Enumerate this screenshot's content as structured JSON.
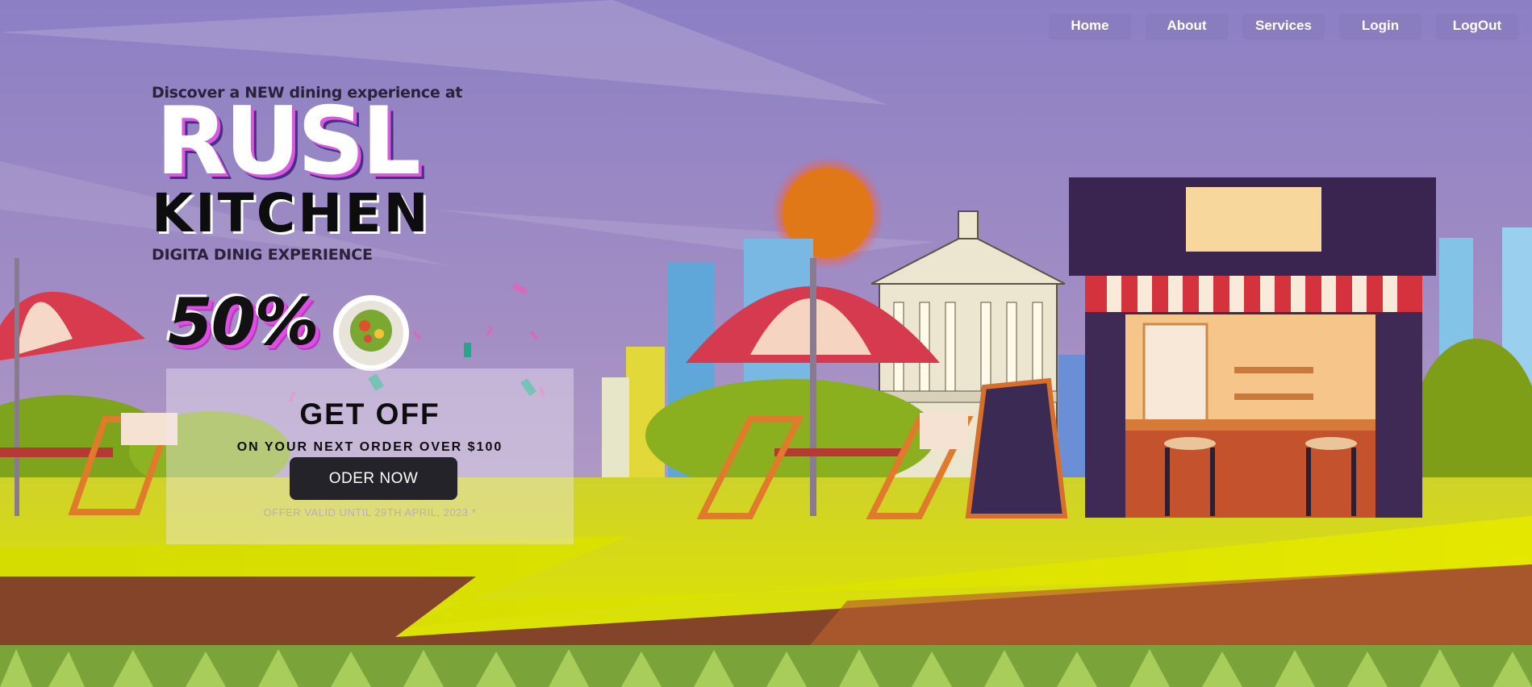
{
  "nav": {
    "items": [
      {
        "label": "Home"
      },
      {
        "label": "About"
      },
      {
        "label": "Services"
      },
      {
        "label": "Login"
      },
      {
        "label": "LogOut"
      }
    ]
  },
  "hero": {
    "tagline": "Discover a NEW dining experience at",
    "brand_main": "RUSL",
    "brand_sub": "KITCHEN",
    "brand_tagline": "DIGITA DINIG EXPERIENCE",
    "discount": "50%"
  },
  "offer": {
    "title": "GET OFF",
    "subtitle": "ON YOUR NEXT ORDER OVER $100",
    "button_label": "ODER NOW",
    "note": "OFFER VALID UNTIL 29TH APRIL, 2023 *"
  }
}
